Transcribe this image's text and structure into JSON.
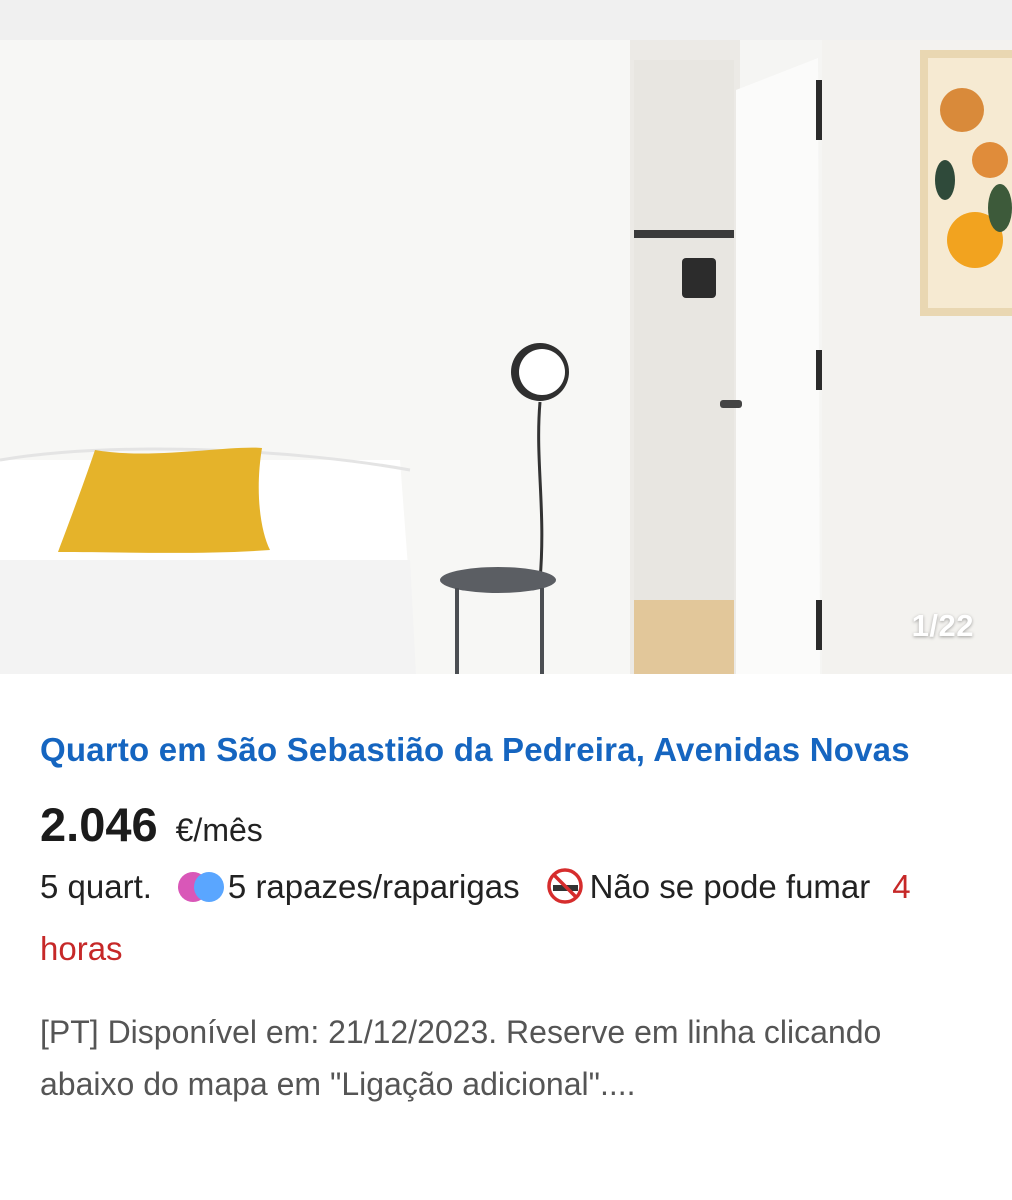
{
  "listing": {
    "photo_counter": "1/22",
    "title": "Quarto em São Sebastião da Pedreira, Avenidas Novas",
    "price": "2.046",
    "price_unit": "€/mês",
    "rooms": "5 quart.",
    "gender_icon": "gender-mixed-icon",
    "gender_label": "5 rapazes/raparigas",
    "smoking_icon": "no-smoking-icon",
    "smoking_label": "Não se pode fumar",
    "posted": "4 horas",
    "description": "[PT] Disponível em: 21/12/2023. Reserve em linha clicando abaixo do mapa em \"Ligação adicional\"...."
  },
  "colors": {
    "title": "#1565c0",
    "posted": "#c62828",
    "dot_pink": "#d957b8",
    "dot_blue": "#5aa6ff"
  }
}
